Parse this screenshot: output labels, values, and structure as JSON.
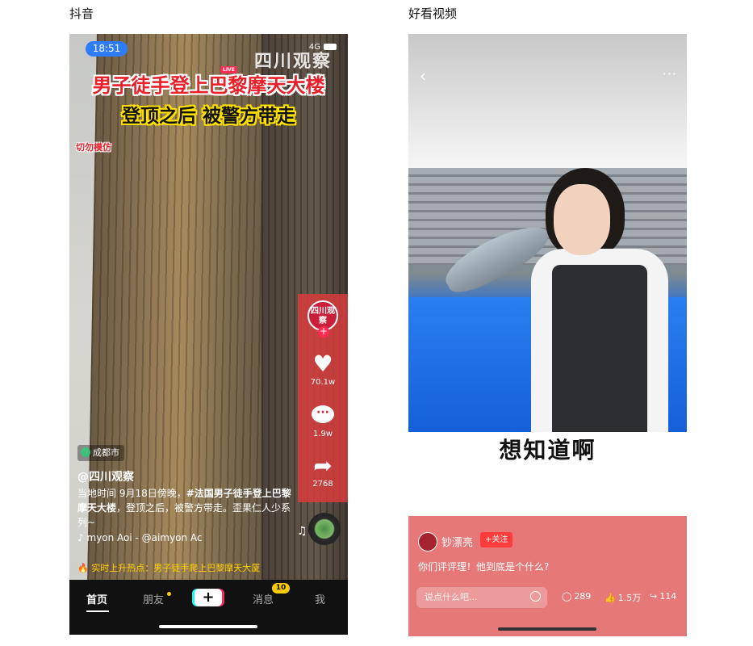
{
  "captions": {
    "left": "抖音",
    "right": "好看视频"
  },
  "douyin": {
    "status": {
      "time": "18:51",
      "network": "4G"
    },
    "watermark": "四川观察",
    "live_badge": "LIVE",
    "headline_line1": "男子徒手登上巴黎摩天大楼",
    "headline_line2": "登顶之后 被警方带走",
    "warning": "切勿模仿",
    "side": {
      "avatar_text": "四川观察",
      "follow": "+",
      "likes": "70.1w",
      "comments": "1.9w",
      "shares": "2768"
    },
    "location": "成都市",
    "author": "@四川观察",
    "description_prefix": "当地时间 9月18日傍晚，",
    "description_tag": "#法国男子徒手登上巴黎摩天大楼",
    "description_suffix": "，登顶之后，被警方带走。歪果仁人少系列~",
    "music": "myon   Aoi - @aimyon   Ac",
    "hot_topic": "实时上升热点：男子徒手爬上巴黎摩天大厦",
    "tabs": {
      "home": "首页",
      "friends": "朋友",
      "add": "+",
      "messages": "消息",
      "me": "我"
    },
    "message_badge": "10"
  },
  "haokan": {
    "subtitle": "想知道啊",
    "username": "钞漂亮",
    "follow": "+关注",
    "question": "你们评评理！他到底是个什么?",
    "comment_placeholder": "说点什么吧...",
    "comments": "289",
    "likes": "1.5万",
    "shares": "114"
  }
}
